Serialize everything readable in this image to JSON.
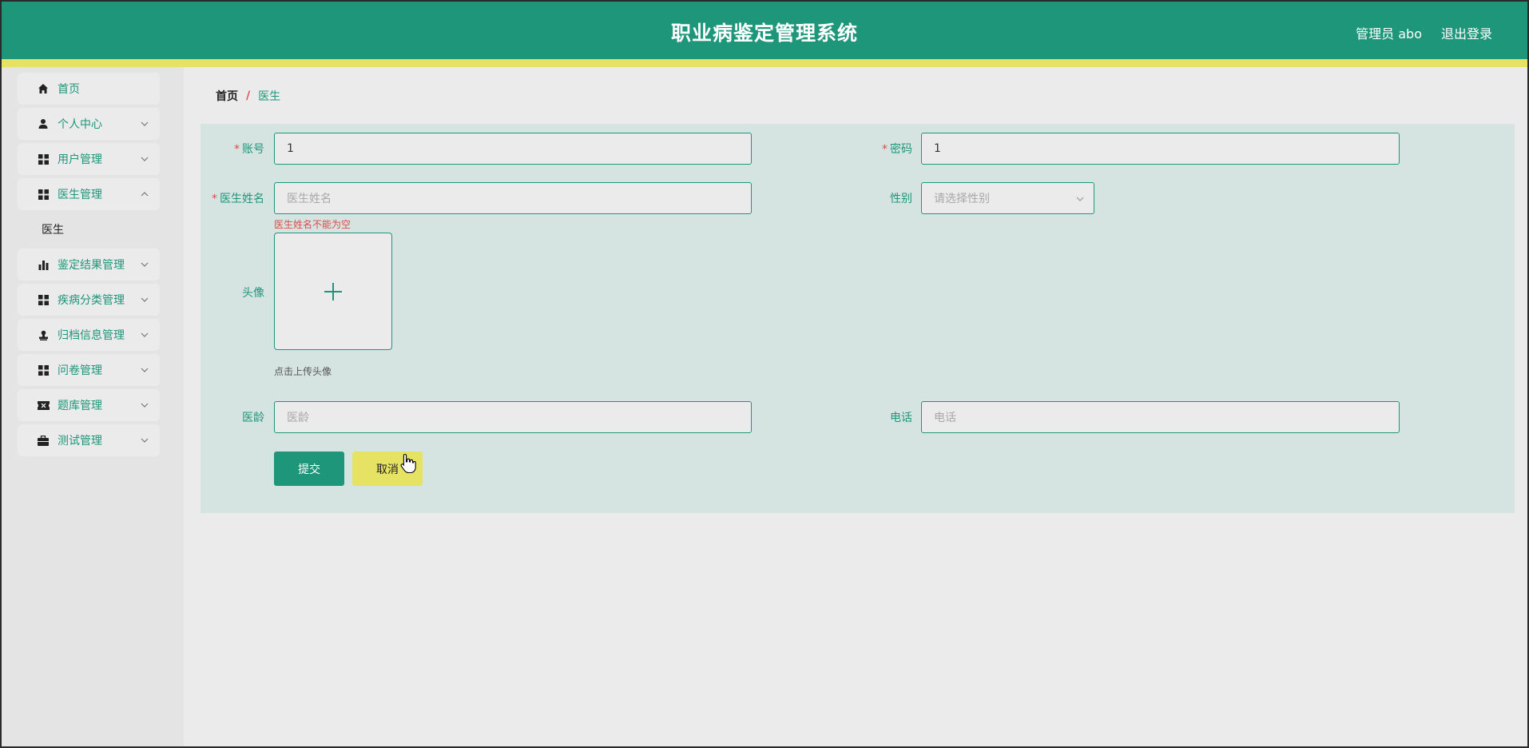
{
  "header": {
    "title": "职业病鉴定管理系统",
    "user": "管理员 abo",
    "logout": "退出登录"
  },
  "sidebar": {
    "items": [
      {
        "label": "首页",
        "icon": "home-icon"
      },
      {
        "label": "个人中心",
        "icon": "user-icon"
      },
      {
        "label": "用户管理",
        "icon": "grid-icon"
      },
      {
        "label": "医生管理",
        "icon": "grid-icon"
      },
      {
        "label": "鉴定结果管理",
        "icon": "bar-chart-icon"
      },
      {
        "label": "疾病分类管理",
        "icon": "grid-icon"
      },
      {
        "label": "归档信息管理",
        "icon": "stamp-icon"
      },
      {
        "label": "问卷管理",
        "icon": "grid-icon"
      },
      {
        "label": "题库管理",
        "icon": "ticket-icon"
      },
      {
        "label": "测试管理",
        "icon": "briefcase-icon"
      }
    ],
    "submenu": "医生"
  },
  "breadcrumb": {
    "home": "首页",
    "separator": "/",
    "current": "医生"
  },
  "form": {
    "account": {
      "label": "账号",
      "value": "1"
    },
    "password": {
      "label": "密码",
      "value": "1"
    },
    "doctor_name": {
      "label": "医生姓名",
      "placeholder": "医生姓名",
      "error": "医生姓名不能为空"
    },
    "gender": {
      "label": "性别",
      "placeholder": "请选择性别"
    },
    "avatar": {
      "label": "头像",
      "tip": "点击上传头像"
    },
    "experience": {
      "label": "医龄",
      "placeholder": "医龄"
    },
    "phone": {
      "label": "电话",
      "placeholder": "电话"
    },
    "submit": "提交",
    "cancel": "取消",
    "required_mark": "*"
  },
  "colors": {
    "primary": "#1e967a",
    "accent": "#e6e263",
    "error": "#e04a4a",
    "panel": "#d6e4e1"
  }
}
